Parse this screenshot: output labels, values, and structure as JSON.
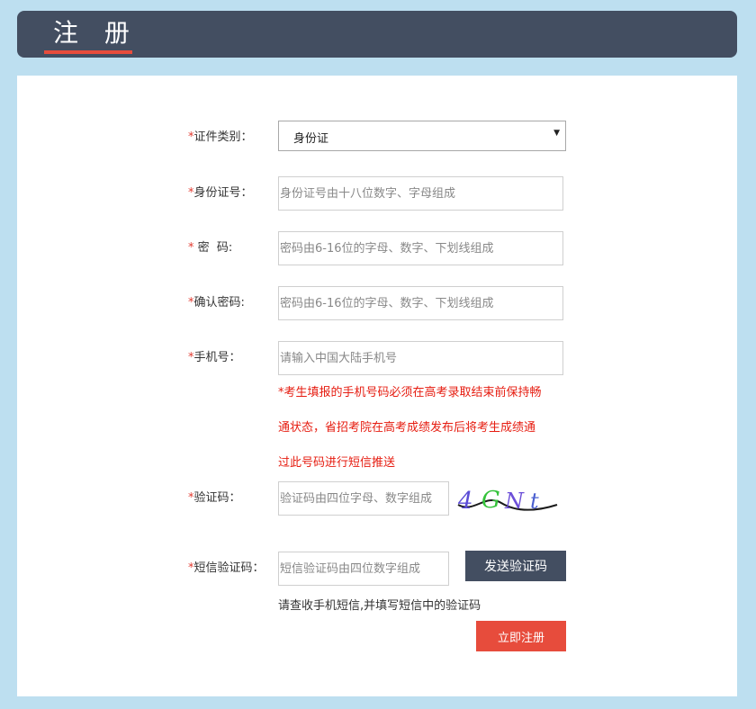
{
  "header": {
    "title": "注 册"
  },
  "form": {
    "id_type": {
      "req": "*",
      "label": "证件类别：",
      "value": "身份证"
    },
    "id_number": {
      "req": "*",
      "label": "身份证号：",
      "placeholder": "身份证号由十八位数字、字母组成",
      "value": ""
    },
    "password": {
      "req": "*",
      "label": " 密  码:",
      "placeholder": "密码由6-16位的字母、数字、下划线组成",
      "value": ""
    },
    "confirm_password": {
      "req": "*",
      "label": "确认密码:",
      "placeholder": "密码由6-16位的字母、数字、下划线组成",
      "value": ""
    },
    "phone": {
      "req": "*",
      "label": "手机号：",
      "placeholder": "请输入中国大陆手机号",
      "value": "",
      "notice_lines": [
        "*考生填报的手机号码必须在高考录取结束前保持畅",
        "通状态，省招考院在高考成绩发布后将考生成绩通",
        "过此号码进行短信推送"
      ]
    },
    "captcha": {
      "req": "*",
      "label": "验证码：",
      "placeholder": "验证码由四位字母、数字组成",
      "value": "",
      "image_text": "4GNt"
    },
    "sms_code": {
      "req": "*",
      "label": "短信验证码：",
      "placeholder": "短信验证码由四位数字组成",
      "value": ""
    },
    "send_button": "发送验证码",
    "hint": "请查收手机短信,并填写短信中的验证码",
    "submit_button": "立即注册"
  },
  "colors": {
    "header_bg": "#434e61",
    "accent_red": "#e74c3c",
    "notice_red": "#e61c10",
    "page_bg": "#bddff0"
  }
}
